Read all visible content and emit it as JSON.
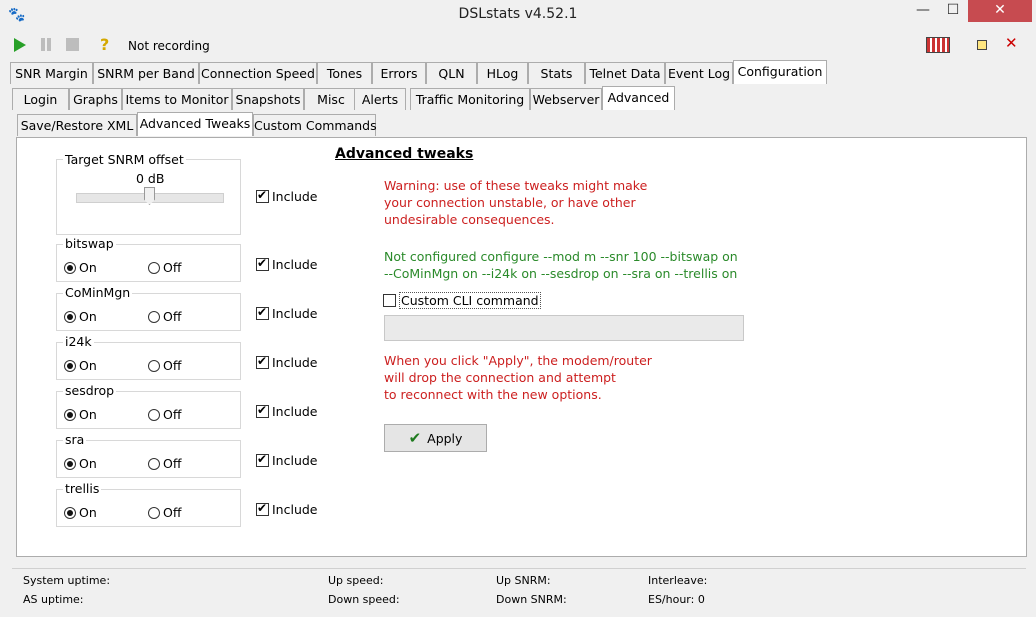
{
  "window": {
    "title": "DSLstats v4.52.1"
  },
  "toolbar": {
    "status": "Not recording"
  },
  "tabs_main": [
    "SNR Margin",
    "SNRM per Band",
    "Connection Speed",
    "Tones",
    "Errors",
    "QLN",
    "HLog",
    "Stats",
    "Telnet Data",
    "Event Log",
    "Configuration"
  ],
  "tabs_config": [
    "Login",
    "Graphs",
    "Items to Monitor",
    "Snapshots",
    "Misc",
    "Alerts",
    "Traffic Monitoring",
    "Webserver",
    "Advanced"
  ],
  "tabs_advanced": [
    "Save/Restore XML",
    "Advanced Tweaks",
    "Custom Commands"
  ],
  "left": {
    "target_label": "Target SNRM offset",
    "target_value": "0 dB",
    "slider_value": 0,
    "include_label": "Include",
    "on_label": "On",
    "off_label": "Off",
    "groups": [
      "bitswap",
      "CoMinMgn",
      "i24k",
      "sesdrop",
      "sra",
      "trellis"
    ]
  },
  "right": {
    "heading": "Advanced tweaks",
    "warning": [
      "Warning: use of these tweaks might make",
      "your connection unstable, or have other",
      "undesirable consequences."
    ],
    "configure": [
      "Not configured configure --mod m --snr 100 --bitswap on",
      "--CoMinMgn on --i24k on --sesdrop on --sra on --trellis on"
    ],
    "custom_cli_label": "Custom CLI command",
    "custom_cli_value": "",
    "apply_note": [
      "When you click \"Apply\", the modem/router",
      "will drop the connection and attempt",
      "to reconnect with the new options."
    ],
    "apply_label": "Apply"
  },
  "statusbar": {
    "system_uptime": "System uptime:",
    "as_uptime": "AS uptime:",
    "up_speed": "Up speed:",
    "down_speed": "Down speed:",
    "up_snrm": "Up SNRM:",
    "down_snrm": "Down SNRM:",
    "interleave": "Interleave:",
    "es_hour": "ES/hour: 0"
  },
  "colors": {
    "warning": "#cc1f1f",
    "info": "#2a8a2a",
    "close": "#c74b50"
  }
}
